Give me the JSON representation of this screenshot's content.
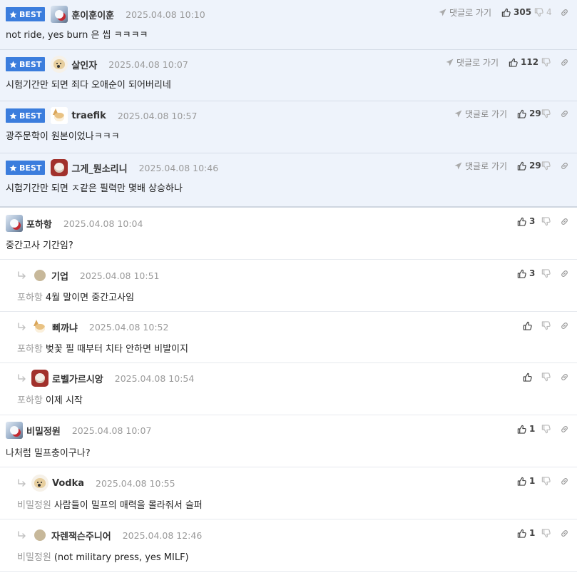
{
  "labels": {
    "best": "BEST",
    "goto": "댓글로 가기"
  },
  "comments": [
    {
      "id": "c1",
      "best": true,
      "avatar": "ice",
      "nick": "훈이훈이훈",
      "time": "2025.04.08 10:10",
      "text": "not ride, yes burn 은 씹 ㅋㅋㅋㅋ",
      "goto": true,
      "up": "305",
      "down": "4"
    },
    {
      "id": "c2",
      "best": true,
      "avatar": "puppy",
      "nick": "살인자",
      "time": "2025.04.08 10:07",
      "text": "시험기간만 되면 죄다 오애순이 되어버리네",
      "goto": true,
      "up": "112",
      "down": ""
    },
    {
      "id": "c3",
      "best": true,
      "avatar": "fox",
      "nick": "traefik",
      "time": "2025.04.08 10:57",
      "text": "광주문학이 원본이었나ㅋㅋㅋ",
      "goto": true,
      "up": "29",
      "down": ""
    },
    {
      "id": "c4",
      "best": true,
      "avatar": "dog2",
      "nick": "그게_뭔소리니",
      "time": "2025.04.08 10:46",
      "text": "시험기간만 되면 ㅈ같은 필력만 몇배 상승하나",
      "goto": true,
      "up": "29",
      "down": ""
    },
    {
      "id": "c5",
      "best": false,
      "avatar": "ice",
      "nick": "포하항",
      "time": "2025.04.08 10:04",
      "text": "중간고사 기간임?",
      "up": "3",
      "down": ""
    },
    {
      "id": "c6",
      "reply": true,
      "avatar": "dot",
      "nick": "기업",
      "time": "2025.04.08 10:51",
      "mention": "포하항",
      "text": "4월 말이면 중간고사임",
      "up": "3",
      "down": ""
    },
    {
      "id": "c7",
      "reply": true,
      "avatar": "fox",
      "nick": "삐까냐",
      "time": "2025.04.08 10:52",
      "mention": "포하항",
      "text": "벚꽃 필 때부터 치타 안하면 비발이지",
      "up": "",
      "down": ""
    },
    {
      "id": "c8",
      "reply": true,
      "avatar": "dog2",
      "nick": "로벨가르시앙",
      "time": "2025.04.08 10:54",
      "mention": "포하항",
      "text": "이제 시작",
      "up": "",
      "down": ""
    },
    {
      "id": "c9",
      "best": false,
      "avatar": "ice",
      "nick": "비밀정원",
      "time": "2025.04.08 10:07",
      "text": "나처럼 밀프충이구나?",
      "up": "1",
      "down": ""
    },
    {
      "id": "c10",
      "reply": true,
      "avatar": "puppy",
      "nick": "Vodka",
      "time": "2025.04.08 10:55",
      "mention": "비밀정원",
      "text": "사람들이 밀프의 매력을 몰라줘서 슬퍼",
      "up": "1",
      "down": ""
    },
    {
      "id": "c11",
      "reply": true,
      "avatar": "dot",
      "nick": "자렌잭슨주니어",
      "time": "2025.04.08 12:46",
      "mention": "비밀정원",
      "text": "(not military press, yes MILF)",
      "up": "1",
      "down": ""
    }
  ]
}
